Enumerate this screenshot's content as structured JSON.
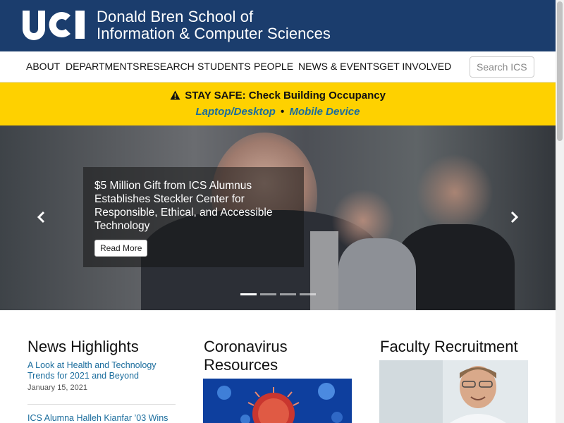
{
  "header": {
    "logo_text": "UCI",
    "school_line1": "Donald Bren School of",
    "school_line2": "Information & Computer Sciences"
  },
  "nav": {
    "items": [
      "About",
      "Departments",
      "Research",
      "Students",
      "People",
      "News & Events",
      "Get Involved"
    ],
    "search_placeholder": "Search ICS"
  },
  "alert": {
    "title": "STAY SAFE: Check Building Occupancy",
    "link1": "Laptop/Desktop",
    "separator": "•",
    "link2": "Mobile Device"
  },
  "hero": {
    "caption": "$5 Million Gift from ICS Alumnus Establishes Steckler Center for Responsible, Ethical, and Accessible Technology",
    "button": "Read More",
    "prev_icon": "chevron-left-icon",
    "next_icon": "chevron-right-icon",
    "slide_count": 4,
    "active_slide": 1
  },
  "columns": {
    "news": {
      "title": "News Highlights",
      "items": [
        {
          "headline": "A Look at Health and Technology Trends for 2021 and Beyond",
          "date": "January 15, 2021"
        },
        {
          "headline": "ICS Alumna Halleh Kianfar ’03 Wins",
          "date": ""
        }
      ]
    },
    "corona": {
      "title": "Coronavirus Resources"
    },
    "faculty": {
      "title": "Faculty Recruitment"
    }
  },
  "colors": {
    "header_bg": "#1b3d6d",
    "alert_bg": "#fed100",
    "link": "#1b6d9d"
  }
}
